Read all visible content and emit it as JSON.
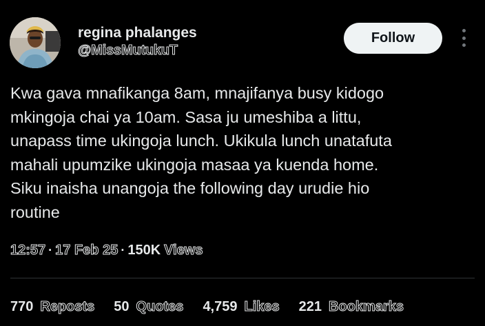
{
  "author": {
    "display_name": "regina phalanges",
    "handle": "@MissMutukuT"
  },
  "follow_label": "Follow",
  "tweet": {
    "lines": [
      "Kwa gava mnafikanga 8am, mnajifanya busy kidogo",
      "mkingoja chai ya 10am. Sasa ju umeshiba a littu,",
      "unapass time ukingoja lunch. Ukikula lunch unatafuta",
      "mahali upumzike ukingoja masaa ya kuenda home.",
      "Siku inaisha unangoja the following day urudie hio",
      "routine"
    ]
  },
  "meta": {
    "time": "12:57",
    "date": "17 Feb 25",
    "views_count": "150K",
    "views_label": "Views",
    "separator": "·"
  },
  "stats": [
    {
      "count": "770",
      "label": "Reposts"
    },
    {
      "count": "50",
      "label": "Quotes"
    },
    {
      "count": "4,759",
      "label": "Likes"
    },
    {
      "count": "221",
      "label": "Bookmarks"
    }
  ],
  "colors": {
    "background": "#000000",
    "text": "#e7e9ea",
    "follow_bg": "#eff3f4",
    "divider": "#2f3336"
  },
  "icons": {
    "more": "more-vertical-icon"
  }
}
